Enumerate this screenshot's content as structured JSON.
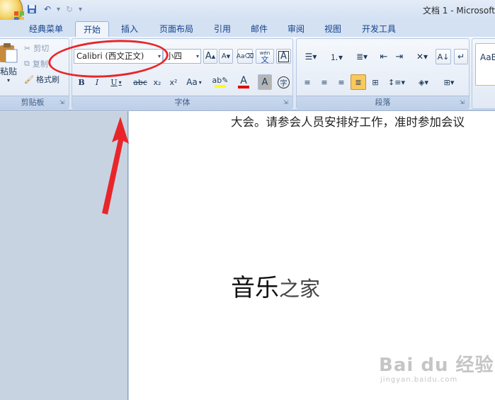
{
  "window": {
    "title": "文档 1 - Microsoft"
  },
  "tabs": [
    {
      "label": "经典菜单"
    },
    {
      "label": "开始"
    },
    {
      "label": "插入"
    },
    {
      "label": "页面布局"
    },
    {
      "label": "引用"
    },
    {
      "label": "邮件"
    },
    {
      "label": "审阅"
    },
    {
      "label": "视图"
    },
    {
      "label": "开发工具"
    }
  ],
  "clipboard": {
    "paste_label": "粘贴",
    "cut_label": "剪切",
    "copy_label": "复制",
    "format_painter_label": "格式刷",
    "group_label": "剪贴板"
  },
  "font": {
    "name_value": "Calibri (西文正文)",
    "size_value": "小四",
    "grow_label": "A",
    "shrink_label": "A",
    "bold_label": "B",
    "italic_label": "I",
    "underline_label": "U",
    "strike_label": "abc",
    "subscript_label": "x₂",
    "superscript_label": "x²",
    "case_label": "Aa",
    "color_label": "A",
    "char_shading_label": "A",
    "enclose_label": "字",
    "pinyin_label": "文",
    "char_border_label": "A",
    "group_label": "字体"
  },
  "paragraph": {
    "group_label": "段落"
  },
  "styles": {
    "preview_label": "AaB"
  },
  "document": {
    "body_text": "大会。请参会人员安排好工作，准时参加会议",
    "heading_big": "音乐",
    "heading_small": "之家"
  },
  "watermark": {
    "logo": "Bai du 经验",
    "url": "jingyan.baidu.com"
  },
  "colors": {
    "annotation": "#e8262a",
    "highlight": "#ffff00",
    "font_color": "#e00000"
  }
}
